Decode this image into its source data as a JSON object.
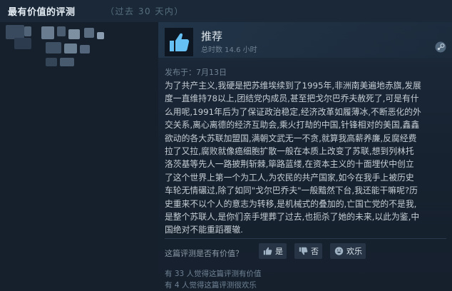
{
  "section": {
    "title": "最有价值的评测",
    "period": "（过去 30 天内）"
  },
  "review": {
    "verdict": "推荐",
    "hours": "总时数 14.6 小时",
    "posted": "发布于：7月13日",
    "text_lines": [
      "为了共产主义,我硬是把苏维埃续到了1995年,非洲南美遍地赤旗,发展",
      "度一直维持78以上,团结党内成员,甚至把戈尔巴乔夫赦死了,可是有什",
      "么用呢,1991年后为了保证政治稳定,经济改革如履薄冰,不断恶化的外",
      "交关系,离心离德的经济互助会,乘火打劫的中国,针锋相对的美国,鑫鑫",
      "欲动的各大苏联加盟国,满朝文武无一不贪,就算我高薪养廉,反腐经费",
      "拉了又拉,腐败就像癌细胞扩散一般在本质上改变了苏联,想到列林托",
      "洛茨基等先人一路披荆斩棘,筚路蓝缕,在资本主义的十面埋伏中创立",
      "了这个世界上第一个为工人,为农民的共产国家,如今在我手上被历史",
      "车轮无情碾过,除了如同\"戈尔巴乔夫\"一般黯然下台,我还能干嘛呢?历",
      "史重来不以个人的意志为转移,是机械式的叠加的,亡国亡党的不是我,",
      "是整个苏联人,是你们亲手埋葬了过去,也扼杀了她的未来,以此为鉴,中",
      "国绝对不能重蹈覆辙."
    ],
    "helpful_question": "这篇评测是否有价值？",
    "buttons": {
      "yes": "是",
      "no": "否",
      "funny": "欢乐"
    },
    "stats": {
      "helpful": "有 33 人觉得这篇评测有价值",
      "funny": "有 4 人觉得这篇评测很欢乐"
    }
  },
  "colors": {
    "background": "#1b2838",
    "card": "#16202d",
    "thumb_up": "#66c0f4",
    "text": "#c4cdd4"
  },
  "icons": [
    "thumbs-up-icon",
    "steam-icon",
    "thumbs-down-icon",
    "laugh-icon"
  ]
}
